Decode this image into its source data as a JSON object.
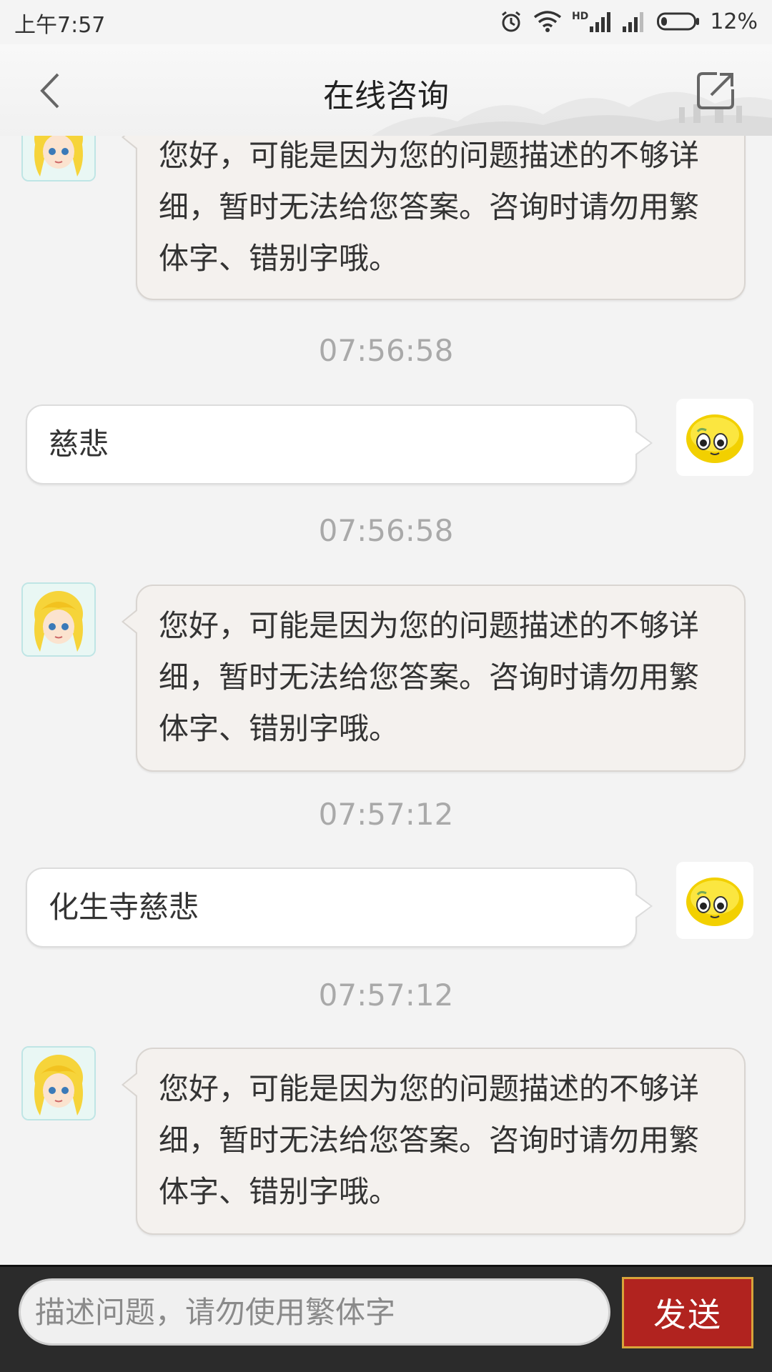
{
  "status_bar": {
    "time": "上午7:57",
    "battery": "12%",
    "signal_label": "HD"
  },
  "header": {
    "title": "在线咨询"
  },
  "messages": [
    {
      "sender": "bot",
      "text": "您好，可能是因为您的问题描述的不够详细，暂时无法给您答案。咨询时请勿用繁体字、错别字哦。"
    },
    {
      "type": "timestamp",
      "text": "07:56:58"
    },
    {
      "sender": "user",
      "text": "慈悲"
    },
    {
      "type": "timestamp",
      "text": "07:56:58"
    },
    {
      "sender": "bot",
      "text": "您好，可能是因为您的问题描述的不够详细，暂时无法给您答案。咨询时请勿用繁体字、错别字哦。"
    },
    {
      "type": "timestamp",
      "text": "07:57:12"
    },
    {
      "sender": "user",
      "text": "化生寺慈悲"
    },
    {
      "type": "timestamp",
      "text": "07:57:12"
    },
    {
      "sender": "bot",
      "text": "您好，可能是因为您的问题描述的不够详细，暂时无法给您答案。咨询时请勿用繁体字、错别字哦。"
    }
  ],
  "input_bar": {
    "placeholder": "描述问题，请勿使用繁体字",
    "send_label": "发送"
  },
  "colors": {
    "send_button": "#b1231f",
    "background": "#f3f3f3",
    "bot_bubble": "#f4f1ee",
    "user_bubble": "#ffffff"
  },
  "icons": [
    "back-arrow-icon",
    "share-icon",
    "alarm-icon",
    "wifi-icon",
    "signal-icon",
    "battery-icon"
  ]
}
